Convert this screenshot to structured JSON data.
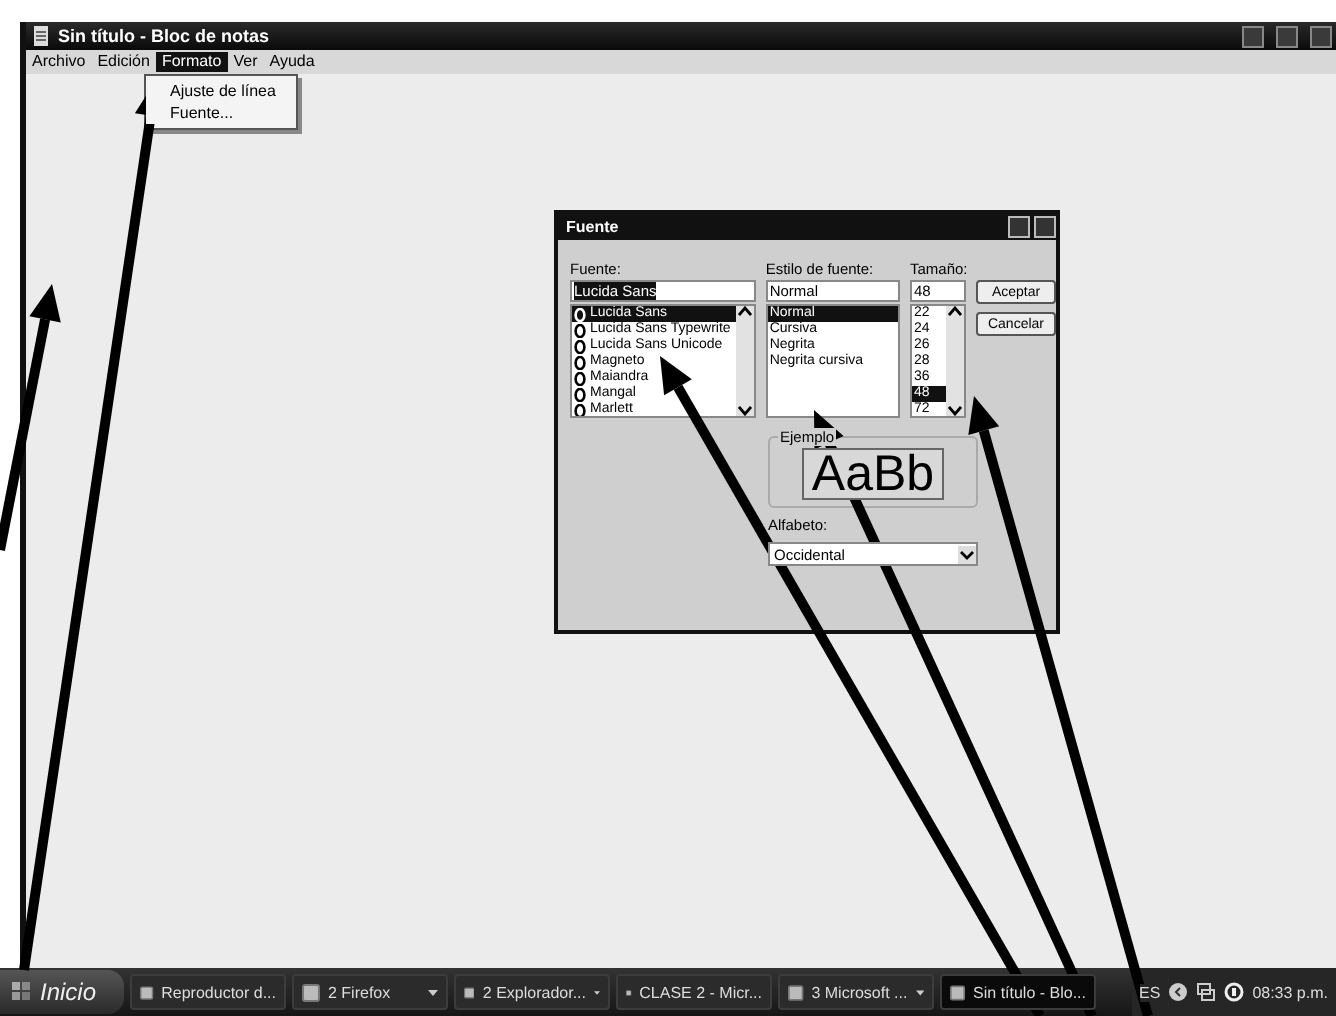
{
  "window": {
    "title": "Sin título - Bloc de notas"
  },
  "menu_bar": [
    {
      "label": "Archivo",
      "selected": false
    },
    {
      "label": "Edición",
      "selected": false
    },
    {
      "label": "Formato",
      "selected": true
    },
    {
      "label": "Ver",
      "selected": false
    },
    {
      "label": "Ayuda",
      "selected": false
    }
  ],
  "format_menu": [
    "Ajuste de línea",
    "Fuente..."
  ],
  "font_dialog": {
    "title": "Fuente",
    "font": {
      "label": "Fuente:",
      "value": "Lucida Sans",
      "items": [
        {
          "name": "Lucida Sans",
          "selected": true
        },
        {
          "name": "Lucida Sans Typewrite",
          "selected": false
        },
        {
          "name": "Lucida Sans Unicode",
          "selected": false
        },
        {
          "name": "Magneto",
          "selected": false
        },
        {
          "name": "Maiandra",
          "selected": false
        },
        {
          "name": "Mangal",
          "selected": false
        },
        {
          "name": "Marlett",
          "selected": false
        }
      ]
    },
    "style": {
      "label": "Estilo de fuente:",
      "value": "Normal",
      "items": [
        {
          "name": "Normal",
          "selected": true
        },
        {
          "name": "Cursiva",
          "selected": false
        },
        {
          "name": "Negrita",
          "selected": false
        },
        {
          "name": "Negrita cursiva",
          "selected": false
        }
      ]
    },
    "size": {
      "label": "Tamaño:",
      "value": "48",
      "items": [
        {
          "name": "22",
          "selected": false
        },
        {
          "name": "24",
          "selected": false
        },
        {
          "name": "26",
          "selected": false
        },
        {
          "name": "28",
          "selected": false
        },
        {
          "name": "36",
          "selected": false
        },
        {
          "name": "48",
          "selected": true
        },
        {
          "name": "72",
          "selected": false
        }
      ]
    },
    "buttons": [
      "Aceptar",
      "Cancelar"
    ],
    "sample": {
      "label": "Ejemplo",
      "text": "AaBb"
    },
    "script": {
      "label": "Alfabeto:",
      "value": "Occidental"
    }
  },
  "taskbar": {
    "start": "Inicio",
    "tasks": [
      {
        "label": "Reproductor d...",
        "selected": false,
        "grouped": false
      },
      {
        "label": "2 Firefox",
        "selected": false,
        "grouped": true
      },
      {
        "label": "2 Explorador...",
        "selected": false,
        "grouped": true
      },
      {
        "label": "CLASE 2 - Micr...",
        "selected": false,
        "grouped": false
      },
      {
        "label": "3 Microsoft ...",
        "selected": false,
        "grouped": true
      },
      {
        "label": "Sin título - Blo...",
        "selected": true,
        "grouped": false
      }
    ],
    "language": "ES",
    "clock": "08:33 p.m."
  }
}
